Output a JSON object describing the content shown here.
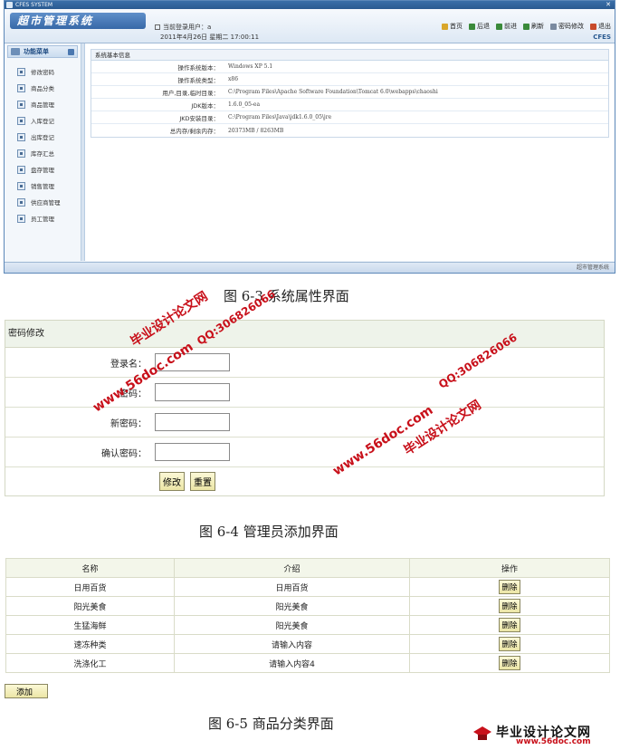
{
  "window": {
    "title": "CFES SYSTEM",
    "brand": "超市管理系统",
    "current_user_label": "当前登录用户：a",
    "datetime": "2011年4月26日  星期二  17:00:11",
    "cfes": "CFES",
    "footer": "超市管理系统"
  },
  "toolbar": [
    {
      "label": "首页",
      "icon": "home-icon",
      "color": "#d9a62a"
    },
    {
      "label": "后退",
      "icon": "back-icon",
      "color": "#3a8a3a"
    },
    {
      "label": "前进",
      "icon": "forward-icon",
      "color": "#3a8a3a"
    },
    {
      "label": "刷新",
      "icon": "refresh-icon",
      "color": "#3a8a3a"
    },
    {
      "label": "密码修改",
      "icon": "key-icon",
      "color": "#7a8aa0"
    },
    {
      "label": "退出",
      "icon": "exit-icon",
      "color": "#c84a2a"
    }
  ],
  "sidebar": {
    "title": "功能菜单",
    "items": [
      {
        "label": "修改密码"
      },
      {
        "label": "商品分类"
      },
      {
        "label": "商品管理"
      },
      {
        "label": "入库登记"
      },
      {
        "label": "出库登记"
      },
      {
        "label": "库存汇总"
      },
      {
        "label": "盘存管理"
      },
      {
        "label": "销售管理"
      },
      {
        "label": "供应商管理"
      },
      {
        "label": "员工管理"
      }
    ]
  },
  "sysinfo": {
    "title": "系统基本信息",
    "rows": [
      {
        "key": "操作系统版本：",
        "value": "Windows XP  5.1"
      },
      {
        "key": "操作系统类型：",
        "value": "x86"
      },
      {
        "key": "用户,目录,临时目录：",
        "value": "C:\\Program Files\\Apache Software Foundation\\Tomcat 6.0\\webapps\\chaoshi"
      },
      {
        "key": "JDK版本：",
        "value": "1.6.0_05-ea"
      },
      {
        "key": "JKD安装目录：",
        "value": "C:\\Program Files\\Java\\jdk1.6.0_05\\jre"
      },
      {
        "key": "总内存/剩余内存：",
        "value": "20373MB  /  8263MB"
      }
    ]
  },
  "captions": {
    "fig1": "图 6-3 系统属性界面",
    "fig2": "图 6-4 管理员添加界面",
    "fig3": "图 6-5 商品分类界面"
  },
  "password_form": {
    "title": "密码修改",
    "fields": [
      {
        "label": "登录名：",
        "value": ""
      },
      {
        "label": "密码：",
        "value": ""
      },
      {
        "label": "新密码：",
        "value": ""
      },
      {
        "label": "确认密码：",
        "value": ""
      }
    ],
    "submit_label": "修改",
    "reset_label": "重置"
  },
  "category_table": {
    "headers": [
      "名称",
      "介绍",
      "操作"
    ],
    "rows": [
      {
        "name": "日用百货",
        "desc": "日用百货",
        "action": "删除"
      },
      {
        "name": "阳光美食",
        "desc": "阳光美食",
        "action": "删除"
      },
      {
        "name": "生猛海鲜",
        "desc": "阳光美食",
        "action": "删除"
      },
      {
        "name": "速冻种类",
        "desc": "请输入内容",
        "action": "删除"
      },
      {
        "name": "洗涤化工",
        "desc": "请输入内容4",
        "action": "删除"
      }
    ],
    "add_label": "添加"
  },
  "watermarks": {
    "site_cn": "毕业设计论文网",
    "site_url": "www.56doc.com",
    "qq": "QQ:306826066",
    "logo_cn": "毕业设计论文网",
    "logo_url": "www.56doc.com"
  }
}
